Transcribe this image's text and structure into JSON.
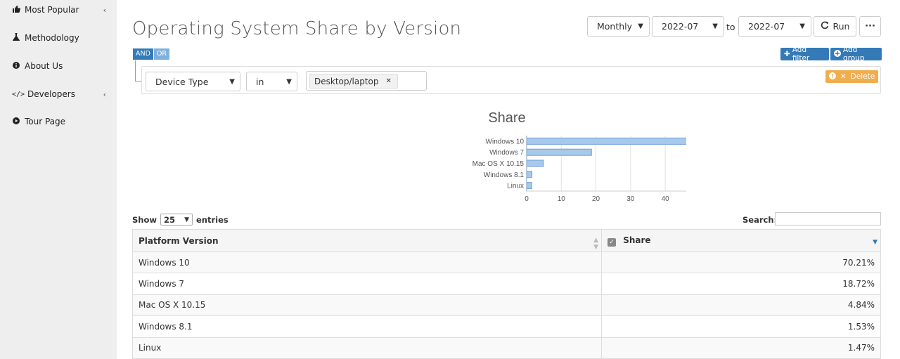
{
  "sidebar": {
    "items": [
      {
        "label": "Most Popular",
        "icon": "thumbs-up-icon",
        "has_chevron": true
      },
      {
        "label": "Methodology",
        "icon": "flask-icon",
        "has_chevron": false
      },
      {
        "label": "About Us",
        "icon": "info-icon",
        "has_chevron": false
      },
      {
        "label": "Developers",
        "icon": "code-icon",
        "has_chevron": true
      },
      {
        "label": "Tour Page",
        "icon": "play-circle-icon",
        "has_chevron": false
      }
    ],
    "chevron": "‹"
  },
  "header": {
    "title": "Operating System Share by Version",
    "period": "Monthly",
    "from": "2022-07",
    "to_label": "to",
    "to": "2022-07",
    "run_label": "Run",
    "more_label": "···"
  },
  "filters": {
    "and_label": "AND",
    "or_label": "OR",
    "add_filter_label": "Add filter",
    "add_group_label": "Add group",
    "field": "Device Type",
    "operator": "in",
    "value_tag": "Desktop/laptop",
    "delete_label": "Delete"
  },
  "chart_data": {
    "type": "bar",
    "orientation": "horizontal",
    "title": "Share",
    "categories": [
      "Windows 10",
      "Windows 7",
      "Mac OS X 10.15",
      "Windows 8.1",
      "Linux"
    ],
    "values": [
      70.21,
      18.72,
      4.84,
      1.53,
      1.47
    ],
    "xlim": [
      0,
      70
    ],
    "xticks": [
      "0",
      "10",
      "20",
      "30",
      "40",
      "50",
      "60",
      "70"
    ],
    "grid": true,
    "bar_color": "#a9c9ec",
    "bar_stroke": "#6f9fd8"
  },
  "table": {
    "show_label": "Show",
    "entries_value": "25",
    "entries_label": "entries",
    "search_label": "Search:",
    "columns": [
      "Platform Version",
      "Share"
    ],
    "rows": [
      [
        "Windows 10",
        "70.21%"
      ],
      [
        "Windows 7",
        "18.72%"
      ],
      [
        "Mac OS X 10.15",
        "4.84%"
      ],
      [
        "Windows 8.1",
        "1.53%"
      ],
      [
        "Linux",
        "1.47%"
      ]
    ]
  },
  "colors": {
    "sidebar_bg": "#eeeeee",
    "primary": "#337ab7",
    "warning": "#f0ad4e"
  }
}
